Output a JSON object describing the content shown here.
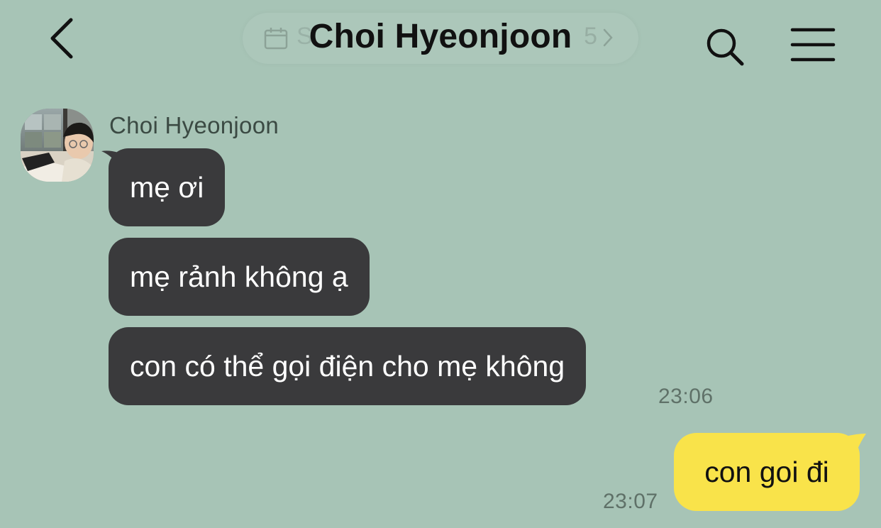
{
  "header": {
    "title": "Choi Hyeonjoon",
    "back_icon": "chevron-left-icon",
    "search_icon": "search-icon",
    "menu_icon": "hamburger-menu-icon",
    "date_pill": {
      "icon": "calendar-icon",
      "text_start": "S",
      "text_end": "5"
    }
  },
  "incoming": {
    "sender_name": "Choi Hyeonjoon",
    "avatar": "profile-photo",
    "messages": [
      "mẹ ơi",
      "mẹ rảnh không ạ",
      "con có thể gọi điện cho mẹ không"
    ],
    "time": "23:06"
  },
  "outgoing": {
    "messages": [
      "con goi đi"
    ],
    "time": "23:07"
  },
  "colors": {
    "background": "#a7c4b6",
    "incoming_bubble": "#3a3a3c",
    "outgoing_bubble": "#f9e34a",
    "timestamp": "#5f7168"
  }
}
